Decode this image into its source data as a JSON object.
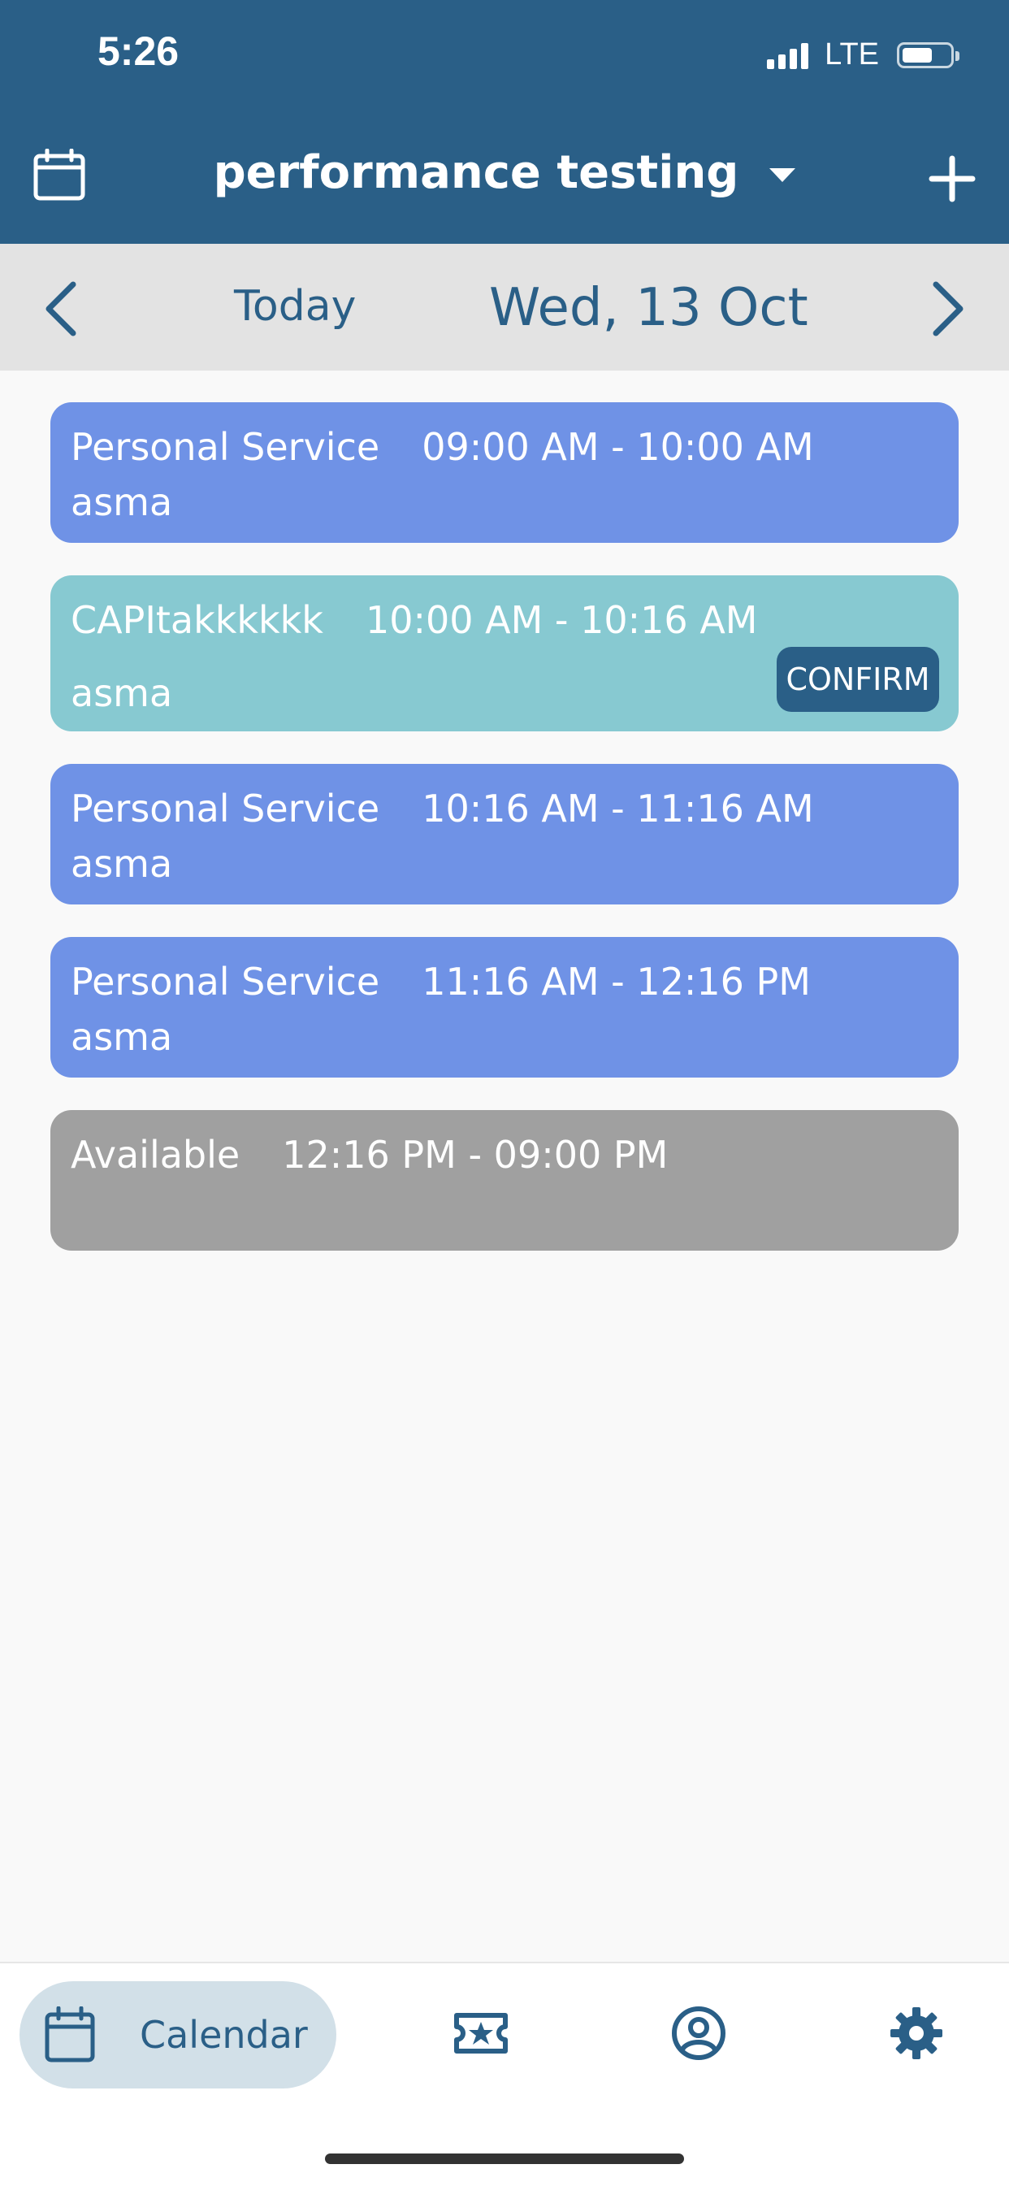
{
  "status_bar": {
    "time": "5:26",
    "network": "LTE"
  },
  "header": {
    "title": "performance testing",
    "icons": {
      "left": "calendar-icon",
      "dropdown": "caret-down-icon",
      "right": "plus-icon"
    }
  },
  "date_nav": {
    "today_label": "Today",
    "current_date": "Wed, 13 Oct",
    "icons": {
      "prev": "chevron-left-icon",
      "next": "chevron-right-icon"
    }
  },
  "events": [
    {
      "service": "Personal Service",
      "time": "09:00 AM - 10:00 AM",
      "client": "asma",
      "type": "service",
      "color": "#6f92e6"
    },
    {
      "service": "CAPItakkkkkk",
      "time": "10:00 AM - 10:16 AM",
      "client": "asma",
      "type": "booking",
      "color": "#87c9d1",
      "action_label": "CONFIRM"
    },
    {
      "service": "Personal Service",
      "time": "10:16 AM - 11:16 AM",
      "client": "asma",
      "type": "service",
      "color": "#6f92e6"
    },
    {
      "service": "Personal Service",
      "time": "11:16 AM - 12:16 PM",
      "client": "asma",
      "type": "service",
      "color": "#6f92e6"
    },
    {
      "service": "Available",
      "time": "12:16 PM - 09:00 PM",
      "client": "",
      "type": "available",
      "color": "#a0a0a0"
    }
  ],
  "bottom_nav": {
    "items": [
      {
        "label": "Calendar",
        "icon": "calendar-icon",
        "active": true
      },
      {
        "label": "",
        "icon": "ticket-star-icon",
        "active": false
      },
      {
        "label": "",
        "icon": "user-circle-icon",
        "active": false
      },
      {
        "label": "",
        "icon": "gear-icon",
        "active": false
      }
    ]
  },
  "colors": {
    "primary": "#2a5f87",
    "date_bar": "#e3e3e3",
    "service_event": "#6f92e6",
    "booking_event": "#87c9d1",
    "available_slot": "#a0a0a0",
    "active_nav_pill": "#d2e0e8"
  }
}
